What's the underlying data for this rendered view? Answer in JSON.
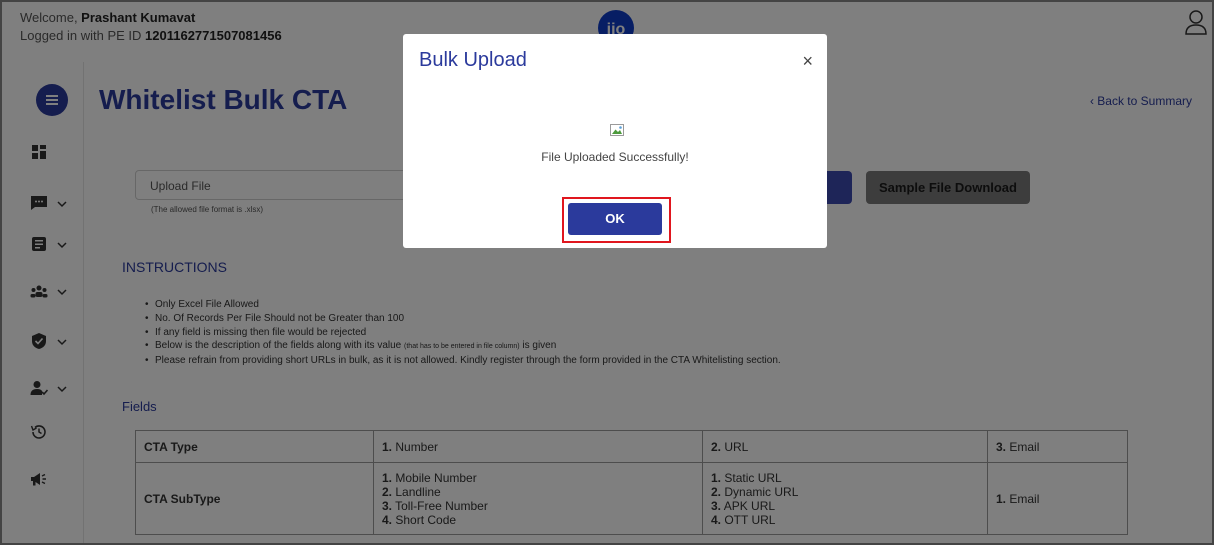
{
  "header": {
    "welcome_prefix": "Welcome, ",
    "user_name": "Prashant Kumavat",
    "logged_prefix": "Logged in with PE ID ",
    "pe_id": "1201162771507081456",
    "logo_text": "jio"
  },
  "sidebar": {
    "items": [
      {
        "icon": "dashboard-icon"
      },
      {
        "icon": "message-icon"
      },
      {
        "icon": "document-icon"
      },
      {
        "icon": "group-icon"
      },
      {
        "icon": "shield-check-icon"
      },
      {
        "icon": "user-check-icon"
      },
      {
        "icon": "history-icon"
      },
      {
        "icon": "megaphone-icon"
      }
    ]
  },
  "page": {
    "title": "Whitelist Bulk CTA",
    "back_link": "Back to Summary",
    "upload_label": "Upload File",
    "upload_hint": "(The allowed file format is .xlsx)",
    "sample_button": "Sample File Download",
    "instructions_title": "INSTRUCTIONS",
    "instructions": [
      "Only Excel File Allowed",
      "No. Of Records Per File Should not be Greater than 100",
      "If any field is missing then file would be rejected"
    ],
    "instruction_4_a": "Below is the description of the fields along with its value ",
    "instruction_4_b": "(that has to be entered in file column)",
    "instruction_4_c": " is given",
    "instruction_5": "Please refrain from providing short URLs in bulk, as it is not allowed. Kindly register through the form provided in the CTA Whitelisting section.",
    "fields_title": "Fields"
  },
  "table": {
    "row1": {
      "head": "CTA Type",
      "c1n": "1.",
      "c1": " Number",
      "c2n": "2.",
      "c2": " URL",
      "c3n": "3.",
      "c3": " Email"
    },
    "row2": {
      "head": "CTA SubType",
      "col1": [
        {
          "n": "1.",
          "t": " Mobile Number"
        },
        {
          "n": "2.",
          "t": " Landline"
        },
        {
          "n": "3.",
          "t": " Toll-Free Number"
        },
        {
          "n": "4.",
          "t": " Short Code"
        }
      ],
      "col2": [
        {
          "n": "1.",
          "t": " Static URL"
        },
        {
          "n": "2.",
          "t": " Dynamic URL"
        },
        {
          "n": "3.",
          "t": " APK URL"
        },
        {
          "n": "4.",
          "t": " OTT URL"
        }
      ],
      "col3n": "1.",
      "col3": " Email"
    }
  },
  "modal": {
    "title": "Bulk Upload",
    "close": "×",
    "message": "File Uploaded Successfully!",
    "ok": "OK"
  },
  "colors": {
    "brand": "#2b3a9c",
    "highlight": "#e0161e"
  }
}
